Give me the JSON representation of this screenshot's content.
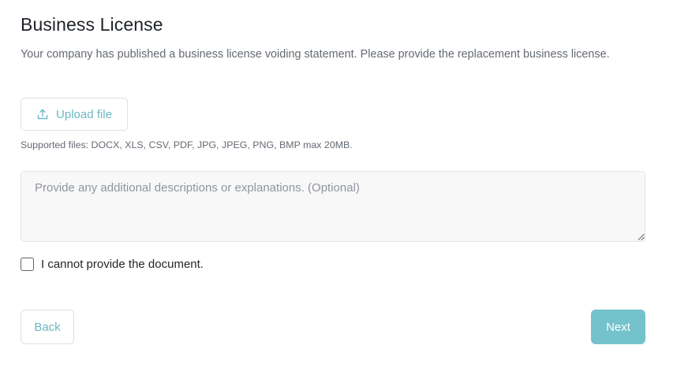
{
  "header": {
    "title": "Business License",
    "subtitle": "Your company has published a business license voiding statement. Please provide the replacement business license."
  },
  "upload": {
    "label": "Upload file",
    "icon": "upload-icon",
    "supported_text": "Supported files: DOCX, XLS, CSV, PDF, JPG, JPEG, PNG, BMP max 20MB."
  },
  "description": {
    "value": "",
    "placeholder": "Provide any additional descriptions or explanations. (Optional)"
  },
  "cannot_provide": {
    "label": "I cannot provide the document.",
    "checked": false
  },
  "footer": {
    "back_label": "Back",
    "next_label": "Next"
  },
  "colors": {
    "accent": "#74c2cb",
    "accent_text": "#6cb8c4",
    "title_text": "#1f2329",
    "muted_text": "#646a73"
  }
}
